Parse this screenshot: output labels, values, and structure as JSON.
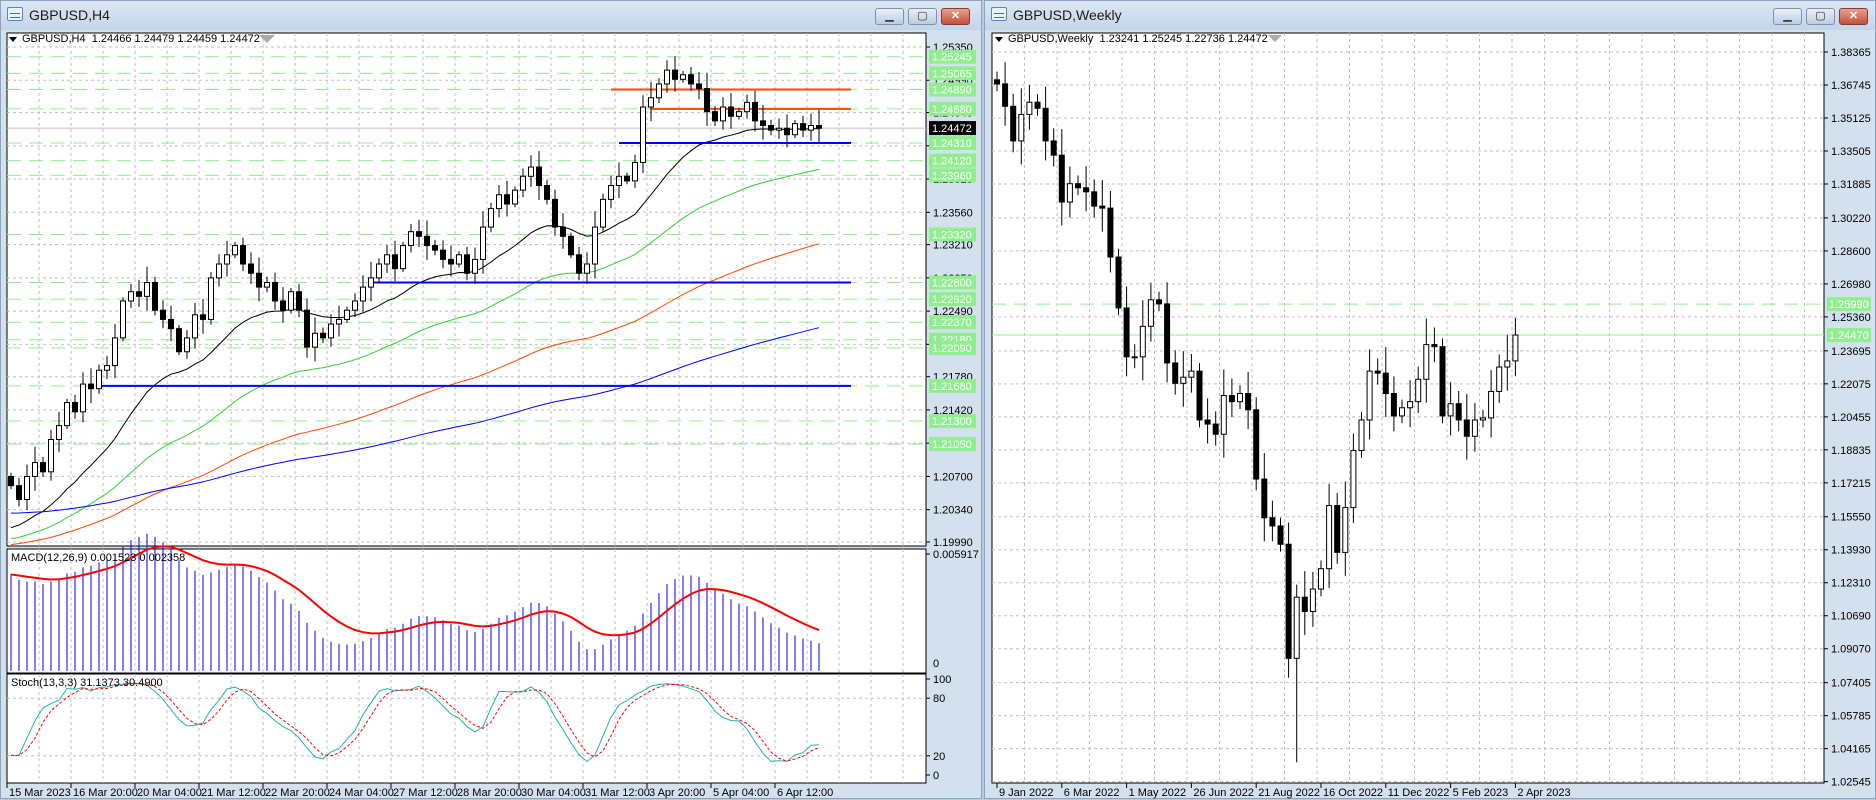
{
  "left_window": {
    "title": "GBPUSD,H4",
    "header_symbol": "GBPUSD,H4",
    "header_ohlc": "1.24466 1.24479 1.24459 1.24472",
    "macd_label": "MACD(12,26,9) 0.001523 0.002358",
    "stoch_label": "Stoch(13,3,3) 31.1373 30.4900",
    "price_ticks": [
      "1.25350",
      "1.24990",
      "1.24640",
      "1.24280",
      "1.23920",
      "1.23560",
      "1.23210",
      "1.22850",
      "1.22490",
      "1.22130",
      "1.21780",
      "1.21420",
      "1.21060",
      "1.20700",
      "1.20340",
      "1.19990"
    ],
    "level_labels": [
      "1.25245",
      "1.25065",
      "1.24890",
      "1.24680",
      "1.24310",
      "1.24120",
      "1.23960",
      "1.23320",
      "1.22800",
      "1.22620",
      "1.22370",
      "1.22180",
      "1.22090",
      "1.21680",
      "1.21300",
      "1.21050"
    ],
    "current_price": "1.24472",
    "macd_scale": [
      "0.005917",
      "0"
    ],
    "stoch_scale": [
      "100",
      "80",
      "20",
      "0"
    ],
    "time_labels": [
      "15 Mar 2023",
      "16 Mar 20:00",
      "20 Mar 04:00",
      "21 Mar 12:00",
      "22 Mar 20:00",
      "24 Mar 04:00",
      "27 Mar 12:00",
      "28 Mar 20:00",
      "30 Mar 04:00",
      "31 Mar 12:00",
      "3 Apr 20:00",
      "5 Apr 04:00",
      "6 Apr 12:00"
    ]
  },
  "right_window": {
    "title": "GBPUSD,Weekly",
    "header_symbol": "GBPUSD,Weekly",
    "header_ohlc": "1.23241 1.25245 1.22736 1.24472",
    "price_ticks": [
      "1.38365",
      "1.36745",
      "1.35125",
      "1.33505",
      "1.31885",
      "1.30220",
      "1.28600",
      "1.26980",
      "1.25360",
      "1.23695",
      "1.22075",
      "1.20455",
      "1.18835",
      "1.17215",
      "1.15550",
      "1.13930",
      "1.12310",
      "1.10690",
      "1.09070",
      "1.07405",
      "1.05785",
      "1.04165",
      "1.02545"
    ],
    "level_labels": [
      "1.25990",
      "1.24470"
    ],
    "time_labels": [
      "9 Jan 2022",
      "6 Mar 2022",
      "1 May 2022",
      "26 Jun 2022",
      "21 Aug 2022",
      "16 Oct 2022",
      "11 Dec 2022",
      "5 Feb 2023",
      "2 Apr 2023"
    ]
  },
  "window_buttons": {
    "minimize": "minimize-icon",
    "maximize": "maximize-icon",
    "close": "close-icon"
  },
  "colors": {
    "bull": "#ffffff",
    "bear": "#000000",
    "level": "#90ee90",
    "ma_fast": "#000000",
    "ma_mid": "#32cd32",
    "ma_slow": "#ff4500",
    "ma_long": "#0000ff",
    "macd_hist": "#0000ff",
    "macd_signal": "#ff0000",
    "stoch_main": "#20b2aa",
    "stoch_signal": "#ff0000",
    "hline_red": "#ff4500",
    "hline_blue": "#0000ff"
  },
  "chart_data": [
    {
      "type": "candlestick",
      "title": "GBPUSD,H4",
      "first_open": 1.207,
      "closes": [
        1.206,
        1.2045,
        1.207,
        1.2085,
        1.2075,
        1.211,
        1.2125,
        1.215,
        1.214,
        1.217,
        1.2165,
        1.2185,
        1.219,
        1.222,
        1.226,
        1.227,
        1.2265,
        1.228,
        1.225,
        1.224,
        1.223,
        1.2205,
        1.222,
        1.2245,
        1.224,
        1.2285,
        1.23,
        1.231,
        1.232,
        1.23,
        1.229,
        1.2275,
        1.228,
        1.226,
        1.225,
        1.227,
        1.225,
        1.221,
        1.2225,
        1.222,
        1.2235,
        1.224,
        1.225,
        1.226,
        1.2275,
        1.2285,
        1.23,
        1.231,
        1.2295,
        1.232,
        1.2335,
        1.233,
        1.232,
        1.2315,
        1.2305,
        1.23,
        1.231,
        1.229,
        1.2305,
        1.234,
        1.236,
        1.2375,
        1.2365,
        1.238,
        1.2395,
        1.2405,
        1.2385,
        1.237,
        1.234,
        1.233,
        1.231,
        1.229,
        1.23,
        1.234,
        1.237,
        1.2385,
        1.2395,
        1.239,
        1.241,
        1.247,
        1.248,
        1.2495,
        1.251,
        1.25,
        1.2505,
        1.2495,
        1.249,
        1.2465,
        1.2455,
        1.247,
        1.246,
        1.2465,
        1.2475,
        1.2455,
        1.245,
        1.2445,
        1.2447,
        1.244,
        1.2452,
        1.2445,
        1.245,
        1.2447
      ],
      "moving_averages": [
        {
          "name": "MA fast",
          "period": 21,
          "start": 1.201,
          "color_key": "ma_fast"
        },
        {
          "name": "MA mid",
          "period": 50,
          "start": 1.2,
          "color_key": "ma_mid"
        },
        {
          "name": "MA slow",
          "period": 100,
          "start": 1.1995,
          "color_key": "ma_slow"
        },
        {
          "name": "MA long",
          "period": 200,
          "start": 1.203,
          "color_key": "ma_long"
        }
      ],
      "horizontal_lines": [
        {
          "price": 1.2489,
          "from_bar": 75,
          "color_key": "hline_red"
        },
        {
          "price": 1.2468,
          "from_bar": 80,
          "color_key": "hline_red"
        },
        {
          "price": 1.2431,
          "from_bar": 76,
          "color_key": "hline_blue"
        },
        {
          "price": 1.228,
          "from_bar": 45,
          "color_key": "hline_blue"
        },
        {
          "price": 1.2168,
          "from_bar": 11,
          "color_key": "hline_blue"
        }
      ],
      "ylim": [
        1.1999,
        1.2535
      ],
      "macd": {
        "fast": 12,
        "slow": 26,
        "signal": 9,
        "max": 0.005917
      },
      "stoch": {
        "k": 13,
        "d": 3,
        "slowing": 3
      }
    },
    {
      "type": "candlestick",
      "title": "GBPUSD,Weekly",
      "first_open": 1.37,
      "closes": [
        1.368,
        1.357,
        1.34,
        1.353,
        1.359,
        1.356,
        1.34,
        1.333,
        1.31,
        1.319,
        1.317,
        1.315,
        1.308,
        1.307,
        1.283,
        1.258,
        1.234,
        1.234,
        1.249,
        1.262,
        1.26,
        1.231,
        1.221,
        1.224,
        1.227,
        1.203,
        1.201,
        1.196,
        1.215,
        1.212,
        1.216,
        1.208,
        1.174,
        1.155,
        1.151,
        1.142,
        1.086,
        1.116,
        1.109,
        1.12,
        1.13,
        1.161,
        1.138,
        1.16,
        1.188,
        1.203,
        1.227,
        1.226,
        1.216,
        1.205,
        1.209,
        1.212,
        1.223,
        1.24,
        1.239,
        1.205,
        1.211,
        1.203,
        1.195,
        1.203,
        1.204,
        1.217,
        1.229,
        1.232,
        1.2447
      ],
      "extreme_low": {
        "bar": 37,
        "price": 1.035
      },
      "ylim": [
        1.02545,
        1.38365
      ]
    }
  ]
}
